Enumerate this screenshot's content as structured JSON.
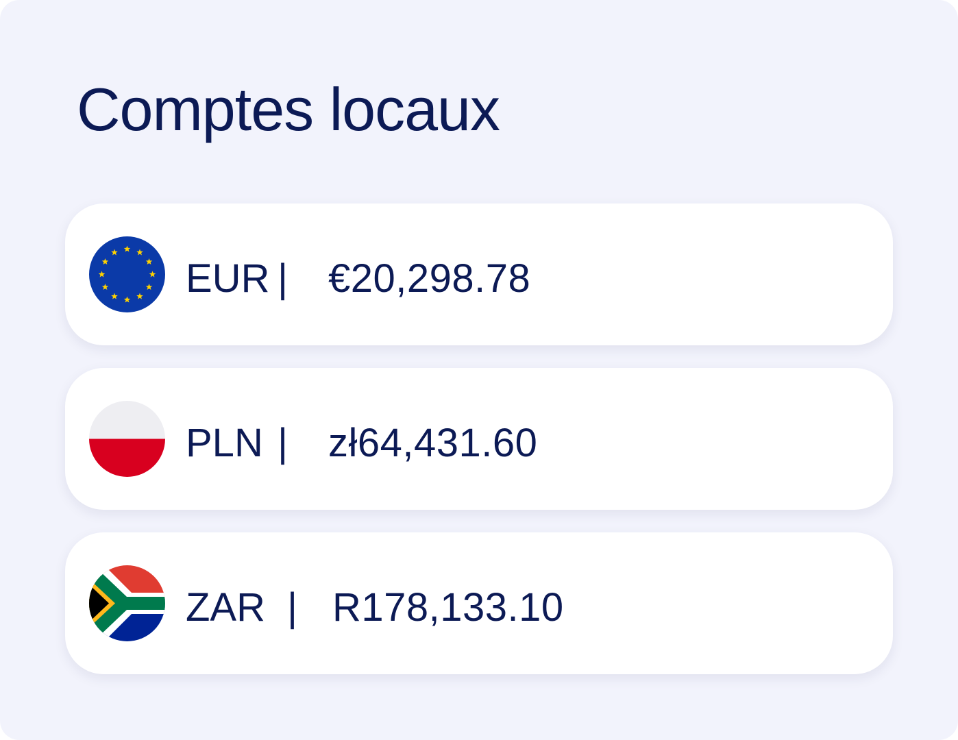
{
  "panel": {
    "title": "Comptes locaux"
  },
  "accounts": [
    {
      "code": "EUR",
      "separator": "|",
      "amount": "€20,298.78",
      "flag_icon": "eu-flag-icon"
    },
    {
      "code": "PLN",
      "separator": "|",
      "amount": "zł64,431.60",
      "flag_icon": "poland-flag-icon"
    },
    {
      "code": "ZAR",
      "separator": "|",
      "amount": "R178,133.10",
      "flag_icon": "south-africa-flag-icon"
    }
  ],
  "colors": {
    "background": "#f2f3fc",
    "card": "#ffffff",
    "text": "#0c1a55",
    "eu_blue": "#0b3aa8",
    "eu_star": "#ffd200",
    "pl_white": "#eeeef2",
    "pl_red": "#d8001f",
    "za_red": "#e03c31",
    "za_blue": "#002395",
    "za_green": "#007a4d",
    "za_gold": "#ffb81c"
  }
}
